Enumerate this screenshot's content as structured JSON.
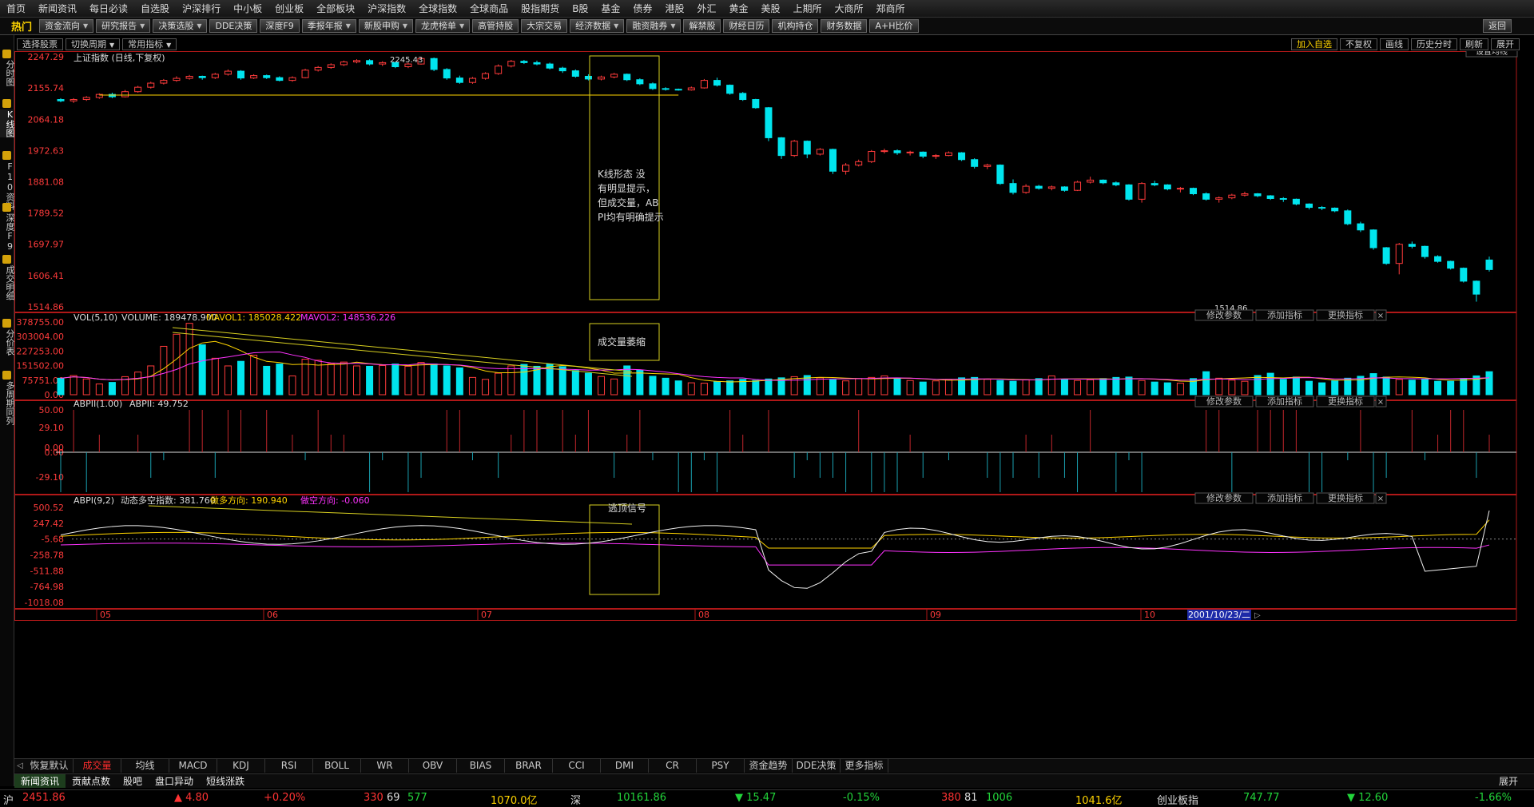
{
  "menu": [
    "首页",
    "新闻资讯",
    "每日必读",
    "自选股",
    "沪深排行",
    "中小板",
    "创业板",
    "全部板块",
    "沪深指数",
    "全球指数",
    "全球商品",
    "股指期货",
    "B股",
    "基金",
    "债券",
    "港股",
    "外汇",
    "黄金",
    "美股",
    "上期所",
    "大商所",
    "郑商所"
  ],
  "toolbar": {
    "hot": "热门",
    "buttons": [
      "资金流向",
      "研究报告",
      "决策选股",
      "DDE决策",
      "深度F9",
      "季报年报",
      "新股申购",
      "龙虎榜单",
      "高管持股",
      "大宗交易",
      "经济数据",
      "融资融券",
      "解禁股",
      "财经日历",
      "机构持仓",
      "财务数据",
      "A+H比价"
    ],
    "back": "返回"
  },
  "left_tabs": [
    "分时图",
    "K线图",
    "F10资料",
    "深度F9",
    "成交明细",
    "分价表",
    "多周期同列"
  ],
  "row2": {
    "left": [
      "选择股票",
      "切换周期",
      "常用指标"
    ],
    "right": [
      "加入自选",
      "不复权",
      "画线",
      "历史分时",
      "刷新",
      "展开"
    ],
    "set_ma": "设置均线"
  },
  "kline": {
    "title": "上证指数 (日线,下复权)",
    "y_ticks": [
      "2247.29",
      "2155.74",
      "2064.18",
      "1972.63",
      "1881.08",
      "1789.52",
      "1697.97",
      "1606.41",
      "1514.86"
    ],
    "high_label": "2245.43",
    "low_label": "1514.86",
    "note": "K线形态 没有明显提示，但成交量，ABPI均有明确提示"
  },
  "vol": {
    "label": "VOL(5,10)",
    "volume": "VOLUME: 189478.900",
    "mavol1": "MAVOL1: 185028.422",
    "mavol2": "MAVOL2: 148536.226",
    "y_ticks": [
      "378755.00",
      "303004.00",
      "227253.00",
      "151502.00",
      "75751.00",
      "0.00"
    ],
    "note": "成交量萎缩"
  },
  "abpii": {
    "label": "ABPII(1.00)",
    "value": "ABPII: 49.752",
    "y_ticks": [
      "50.00",
      "29.10",
      "0.00",
      "0.00",
      "-29.10"
    ]
  },
  "abpi": {
    "label": "ABPI(9,2)",
    "dyn": "动态多空指数: 381.760",
    "bull": "做多方向: 190.940",
    "bear": "做空方向: -0.060",
    "y_ticks": [
      "500.52",
      "247.42",
      "-5.68",
      "-258.78",
      "-511.88",
      "-764.98",
      "-1018.08"
    ],
    "note": "逃顶信号"
  },
  "panel_buttons": [
    "修改参数",
    "添加指标",
    "更换指标"
  ],
  "x_labels": [
    "05",
    "06",
    "07",
    "08",
    "09",
    "10"
  ],
  "date_box": "2001/10/23/二",
  "indicator_tabs": [
    "恢复默认",
    "成交量",
    "均线",
    "MACD",
    "KDJ",
    "RSI",
    "BOLL",
    "WR",
    "OBV",
    "BIAS",
    "BRAR",
    "CCI",
    "DMI",
    "CR",
    "PSY",
    "资金趋势",
    "DDE决策",
    "更多指标"
  ],
  "news_tabs": [
    "新闻资讯",
    "贡献点数",
    "股吧",
    "盘口异动",
    "短线涨跌"
  ],
  "news_expand": "展开",
  "status": {
    "sh_label": "沪",
    "sh_index": "2451.86",
    "sh_change": "▲ 4.80",
    "sh_pct": "+0.20%",
    "sh_up": "330",
    "sh_flat": "69",
    "sh_down": "577",
    "sh_amount": "1070.0亿",
    "sz_label": "深",
    "sz_index": "10161.86",
    "sz_change": "▼ 15.47",
    "sz_pct": "-0.15%",
    "sz_up": "380",
    "sz_flat": "81",
    "sz_down": "1006",
    "sz_amount": "1041.6亿",
    "cy_label": "创业板指",
    "cy_index": "747.77",
    "cy_change": "▼ 12.60",
    "cy_pct": "-1.66%"
  },
  "chart_data": {
    "type": "candlestick",
    "title": "上证指数 (日线,下复权)",
    "x_axis_labels": [
      "05",
      "06",
      "07",
      "08",
      "09",
      "10"
    ],
    "y_range": [
      1514.86,
      2247.29
    ],
    "candles": [
      [
        2122,
        2126,
        2114,
        2118
      ],
      [
        2118,
        2126,
        2112,
        2122
      ],
      [
        2122,
        2132,
        2118,
        2128
      ],
      [
        2128,
        2140,
        2124,
        2137
      ],
      [
        2137,
        2142,
        2126,
        2130
      ],
      [
        2130,
        2150,
        2128,
        2145
      ],
      [
        2145,
        2162,
        2142,
        2158
      ],
      [
        2158,
        2174,
        2154,
        2170
      ],
      [
        2170,
        2182,
        2166,
        2178
      ],
      [
        2178,
        2190,
        2174,
        2184
      ],
      [
        2184,
        2194,
        2180,
        2190
      ],
      [
        2190,
        2192,
        2180,
        2186
      ],
      [
        2186,
        2200,
        2182,
        2196
      ],
      [
        2196,
        2210,
        2192,
        2205
      ],
      [
        2205,
        2208,
        2180,
        2185
      ],
      [
        2185,
        2196,
        2182,
        2192
      ],
      [
        2192,
        2195,
        2182,
        2186
      ],
      [
        2186,
        2190,
        2175,
        2178
      ],
      [
        2178,
        2190,
        2174,
        2186
      ],
      [
        2186,
        2212,
        2184,
        2208
      ],
      [
        2208,
        2220,
        2204,
        2216
      ],
      [
        2216,
        2228,
        2212,
        2224
      ],
      [
        2224,
        2236,
        2220,
        2232
      ],
      [
        2232,
        2240,
        2228,
        2236
      ],
      [
        2236,
        2240,
        2222,
        2226
      ],
      [
        2226,
        2234,
        2220,
        2230
      ],
      [
        2230,
        2232,
        2214,
        2218
      ],
      [
        2218,
        2230,
        2214,
        2226
      ],
      [
        2226,
        2246,
        2224,
        2242
      ],
      [
        2242,
        2245,
        2205,
        2210
      ],
      [
        2210,
        2214,
        2180,
        2185
      ],
      [
        2185,
        2192,
        2168,
        2172
      ],
      [
        2172,
        2188,
        2168,
        2184
      ],
      [
        2184,
        2202,
        2180,
        2198
      ],
      [
        2198,
        2225,
        2194,
        2220
      ],
      [
        2220,
        2238,
        2216,
        2234
      ],
      [
        2234,
        2238,
        2226,
        2230
      ],
      [
        2230,
        2236,
        2222,
        2226
      ],
      [
        2226,
        2230,
        2210,
        2214
      ],
      [
        2214,
        2218,
        2200,
        2206
      ],
      [
        2206,
        2210,
        2186,
        2190
      ],
      [
        2190,
        2196,
        2178,
        2182
      ],
      [
        2182,
        2192,
        2178,
        2188
      ],
      [
        2188,
        2200,
        2184,
        2196
      ],
      [
        2196,
        2198,
        2176,
        2180
      ],
      [
        2180,
        2184,
        2164,
        2168
      ],
      [
        2168,
        2172,
        2150,
        2154
      ],
      [
        2154,
        2158,
        2148,
        2152
      ],
      [
        2152,
        2154,
        2148,
        2150
      ],
      [
        2150,
        2160,
        2148,
        2156
      ],
      [
        2156,
        2182,
        2154,
        2178
      ],
      [
        2178,
        2186,
        2160,
        2164
      ],
      [
        2164,
        2166,
        2136,
        2140
      ],
      [
        2140,
        2144,
        2118,
        2122
      ],
      [
        2122,
        2124,
        2095,
        2098
      ],
      [
        2098,
        2100,
        2000,
        2010
      ],
      [
        2010,
        2012,
        1948,
        1958
      ],
      [
        1958,
        2004,
        1954,
        2000
      ],
      [
        2000,
        2002,
        1950,
        1962
      ],
      [
        1962,
        1980,
        1958,
        1976
      ],
      [
        1976,
        1978,
        1904,
        1912
      ],
      [
        1912,
        1936,
        1902,
        1930
      ],
      [
        1930,
        1946,
        1926,
        1940
      ],
      [
        1940,
        1974,
        1936,
        1970
      ],
      [
        1970,
        1978,
        1964,
        1972
      ],
      [
        1972,
        1976,
        1960,
        1966
      ],
      [
        1966,
        1972,
        1958,
        1968
      ],
      [
        1968,
        1970,
        1950,
        1956
      ],
      [
        1956,
        1962,
        1948,
        1958
      ],
      [
        1958,
        1970,
        1956,
        1966
      ],
      [
        1966,
        1968,
        1942,
        1946
      ],
      [
        1946,
        1950,
        1920,
        1926
      ],
      [
        1926,
        1934,
        1918,
        1930
      ],
      [
        1930,
        1932,
        1872,
        1876
      ],
      [
        1876,
        1888,
        1844,
        1850
      ],
      [
        1850,
        1874,
        1846,
        1868
      ],
      [
        1868,
        1872,
        1858,
        1862
      ],
      [
        1862,
        1870,
        1856,
        1866
      ],
      [
        1866,
        1868,
        1852,
        1856
      ],
      [
        1856,
        1884,
        1854,
        1880
      ],
      [
        1880,
        1896,
        1876,
        1886
      ],
      [
        1886,
        1888,
        1874,
        1878
      ],
      [
        1878,
        1882,
        1868,
        1872
      ],
      [
        1872,
        1874,
        1826,
        1830
      ],
      [
        1830,
        1880,
        1820,
        1876
      ],
      [
        1876,
        1884,
        1868,
        1872
      ],
      [
        1872,
        1874,
        1856,
        1860
      ],
      [
        1860,
        1866,
        1850,
        1862
      ],
      [
        1862,
        1864,
        1842,
        1846
      ],
      [
        1846,
        1850,
        1826,
        1830
      ],
      [
        1830,
        1838,
        1820,
        1834
      ],
      [
        1834,
        1846,
        1830,
        1842
      ],
      [
        1842,
        1852,
        1838,
        1846
      ],
      [
        1846,
        1848,
        1836,
        1840
      ],
      [
        1840,
        1842,
        1828,
        1832
      ],
      [
        1832,
        1836,
        1822,
        1830
      ],
      [
        1830,
        1832,
        1812,
        1816
      ],
      [
        1816,
        1818,
        1800,
        1806
      ],
      [
        1806,
        1810,
        1798,
        1804
      ],
      [
        1804,
        1806,
        1792,
        1796
      ],
      [
        1796,
        1800,
        1754,
        1758
      ],
      [
        1758,
        1764,
        1734,
        1740
      ],
      [
        1740,
        1742,
        1682,
        1688
      ],
      [
        1688,
        1690,
        1638,
        1642
      ],
      [
        1642,
        1702,
        1610,
        1698
      ],
      [
        1698,
        1706,
        1686,
        1692
      ],
      [
        1692,
        1694,
        1656,
        1662
      ],
      [
        1662,
        1666,
        1644,
        1648
      ],
      [
        1648,
        1650,
        1624,
        1628
      ],
      [
        1628,
        1630,
        1586,
        1590
      ],
      [
        1590,
        1592,
        1530,
        1552
      ],
      [
        1652,
        1662,
        1618,
        1624
      ]
    ],
    "volume": [
      {
        "name": "VOLUME",
        "values": [
          86,
          100,
          82,
          56,
          64,
          94,
          118,
          150,
          252,
          315,
          372,
          260,
          190,
          150,
          174,
          206,
          148,
          160,
          98,
          185,
          180,
          162,
          170,
          150,
          148,
          152,
          160,
          148,
          168,
          160,
          150,
          140,
          90,
          80,
          112,
          150,
          158,
          148,
          160,
          146,
          126,
          112,
          95,
          82,
          150,
          128,
          96,
          86,
          72,
          62,
          60,
          68,
          72,
          80,
          74,
          82,
          88,
          94,
          100,
          88,
          78,
          72,
          84,
          90,
          98,
          86,
          74,
          66,
          72,
          80,
          88,
          90,
          80,
          74,
          70,
          78,
          84,
          98,
          80,
          74,
          78,
          84,
          90,
          92,
          74,
          66,
          62,
          60,
          84,
          120,
          86,
          76,
          70,
          100,
          112,
          80,
          92,
          70,
          62,
          72,
          86,
          96,
          110,
          92,
          80,
          76,
          82,
          70,
          70,
          84,
          98,
          120,
          80,
          74,
          68,
          72,
          64,
          80,
          90,
          60,
          68,
          210,
          330,
          360
        ]
      },
      {
        "name": "MAVOL1",
        "values": []
      },
      {
        "name": "MAVOL2",
        "values": []
      }
    ],
    "volume_range": [
      0,
      378755
    ],
    "abpi_range": [
      -1018.08,
      500.52
    ]
  }
}
